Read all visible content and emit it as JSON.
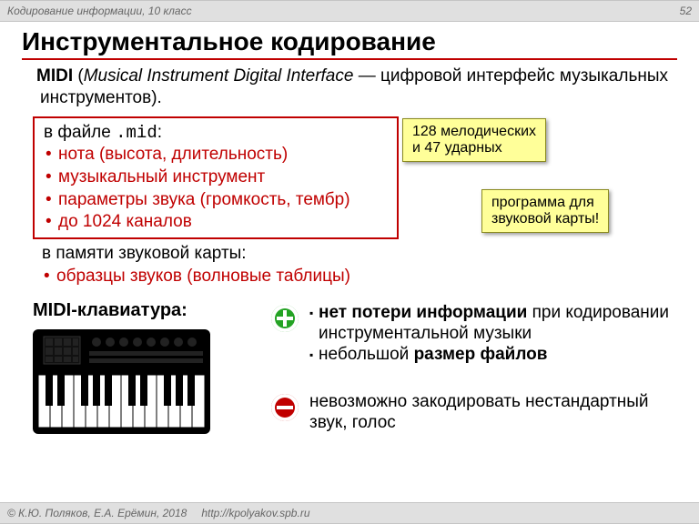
{
  "header": {
    "left": "Кодирование информации, 10 класс",
    "right": "52"
  },
  "title": "Инструментальное кодирование",
  "midi": {
    "abbr": "MIDI",
    "eng": "Musical Instrument Digital Interface",
    "dash": " — ",
    "ru": "цифровой интерфейс музыкальных инструментов)."
  },
  "box": {
    "lead_a": "в файле ",
    "lead_code": ".mid",
    "lead_b": ":",
    "items": [
      "нота (высота, длительность)",
      "музыкальный инструмент",
      "параметры звука (громкость, тембр)",
      "до 1024 каналов"
    ]
  },
  "below": {
    "lead": "в памяти звуковой карты:",
    "items": [
      "образцы звуков (волновые таблицы)"
    ]
  },
  "callout1": {
    "l1": "128 мелодических",
    "l2": "и 47 ударных"
  },
  "callout2": {
    "l1": "программа для",
    "l2": "звуковой карты!"
  },
  "kb_label": "MIDI-клавиатура:",
  "plus": {
    "l1a": "нет потери информации",
    "l1b": " при кодировании инструментальной музыки",
    "l2a": "небольшой ",
    "l2b": "размер файлов"
  },
  "minus": {
    "text": "невозможно закодировать нестандартный звук, голос"
  },
  "footer": {
    "copyright": "© К.Ю. Поляков, Е.А. Ерёмин, 2018",
    "url": "http://kpolyakov.spb.ru"
  }
}
